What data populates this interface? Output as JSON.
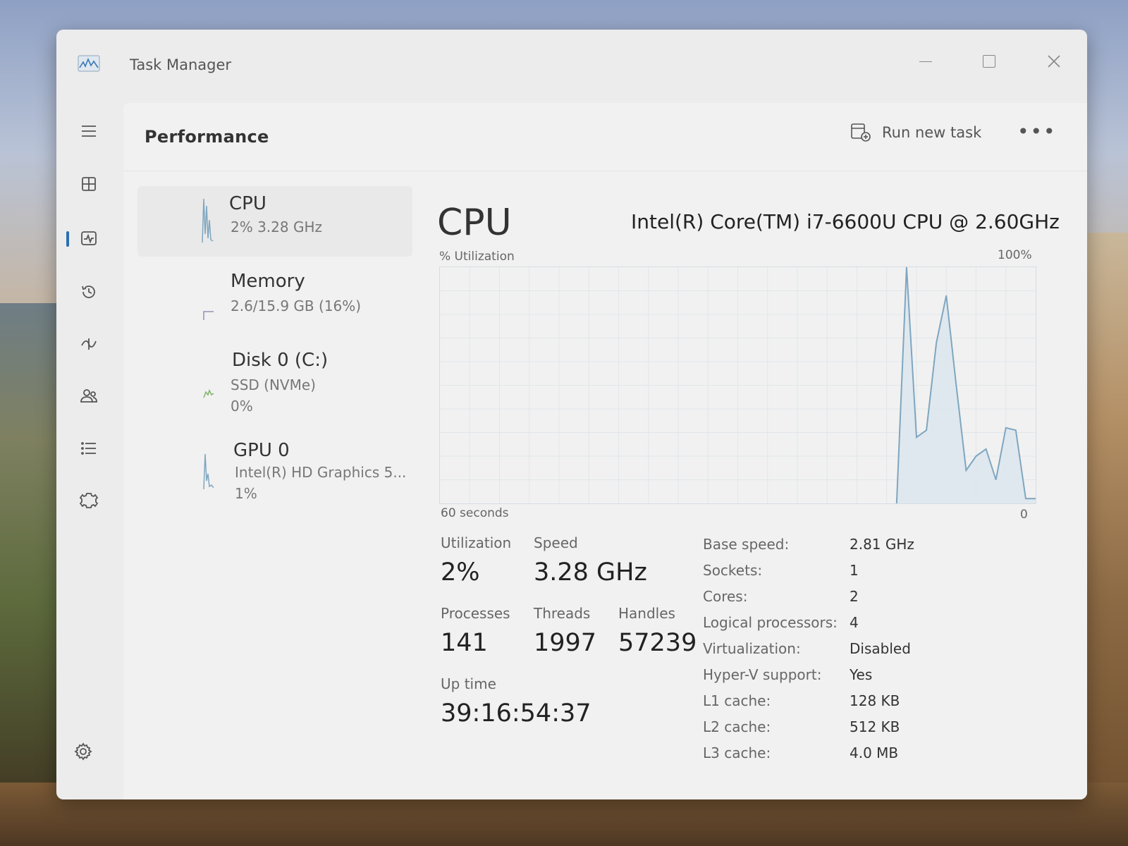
{
  "window": {
    "title": "Task Manager"
  },
  "header": {
    "title": "Performance",
    "run_new_task": "Run new task",
    "more": "•••"
  },
  "sidebar": {
    "items": [
      {
        "name": "hamburger-menu-icon"
      },
      {
        "name": "processes-icon"
      },
      {
        "name": "performance-icon",
        "active": true
      },
      {
        "name": "app-history-icon"
      },
      {
        "name": "startup-apps-icon"
      },
      {
        "name": "users-icon"
      },
      {
        "name": "details-icon"
      },
      {
        "name": "services-icon"
      },
      {
        "name": "settings-icon"
      }
    ]
  },
  "devices": [
    {
      "name": "CPU",
      "sub1": "2%  3.28 GHz",
      "selected": true
    },
    {
      "name": "Memory",
      "sub1": "2.6/15.9 GB (16%)"
    },
    {
      "name": "Disk 0 (C:)",
      "sub1": "SSD (NVMe)",
      "sub2": "0%"
    },
    {
      "name": "GPU 0",
      "sub1": "Intel(R) HD Graphics 5...",
      "sub2": "1%"
    }
  ],
  "main": {
    "title": "CPU",
    "model": "Intel(R) Core(TM) i7-6600U CPU @ 2.60GHz",
    "util_label": "% Utilization",
    "pct_max": "100%",
    "time_label": "60 seconds",
    "zero_label": "0"
  },
  "stats": {
    "utilization_label": "Utilization",
    "utilization": "2%",
    "speed_label": "Speed",
    "speed": "3.28 GHz",
    "processes_label": "Processes",
    "processes": "141",
    "threads_label": "Threads",
    "threads": "1997",
    "handles_label": "Handles",
    "handles": "57239",
    "uptime_label": "Up time",
    "uptime": "39:16:54:37"
  },
  "properties": [
    {
      "key": "Base speed:",
      "value": "2.81 GHz"
    },
    {
      "key": "Sockets:",
      "value": "1"
    },
    {
      "key": "Cores:",
      "value": "2"
    },
    {
      "key": "Logical processors:",
      "value": "4"
    },
    {
      "key": "Virtualization:",
      "value": "Disabled"
    },
    {
      "key": "Hyper-V support:",
      "value": "Yes"
    },
    {
      "key": "L1 cache:",
      "value": "128 KB"
    },
    {
      "key": "L2 cache:",
      "value": "512 KB"
    },
    {
      "key": "L3 cache:",
      "value": "4.0 MB"
    }
  ],
  "chart_data": {
    "type": "area",
    "title": "CPU",
    "xlabel": "60 seconds",
    "ylabel": "% Utilization",
    "ylim": [
      0,
      100
    ],
    "x": [
      0,
      1,
      2,
      3,
      4,
      5,
      6,
      7,
      8,
      9,
      10,
      11,
      12,
      13,
      14,
      15,
      16,
      17,
      18,
      19,
      20,
      21,
      22,
      23,
      24,
      25,
      26,
      27,
      28,
      29,
      30,
      31,
      32,
      33,
      34,
      35,
      36,
      37,
      38,
      39,
      40,
      41,
      42,
      43,
      44,
      45,
      46,
      47,
      48,
      49,
      50,
      51,
      52,
      53,
      54,
      55,
      56,
      57,
      58,
      59,
      60
    ],
    "values": [
      0,
      0,
      0,
      0,
      0,
      0,
      0,
      0,
      0,
      0,
      0,
      0,
      0,
      0,
      0,
      0,
      0,
      0,
      0,
      0,
      0,
      0,
      0,
      0,
      0,
      0,
      0,
      0,
      0,
      0,
      0,
      0,
      0,
      0,
      0,
      0,
      0,
      0,
      0,
      0,
      0,
      0,
      0,
      0,
      0,
      0,
      0,
      100,
      28,
      31,
      68,
      88,
      50,
      14,
      20,
      23,
      10,
      32,
      31,
      2,
      2
    ],
    "grid": true,
    "color": "#7fa6c0"
  }
}
